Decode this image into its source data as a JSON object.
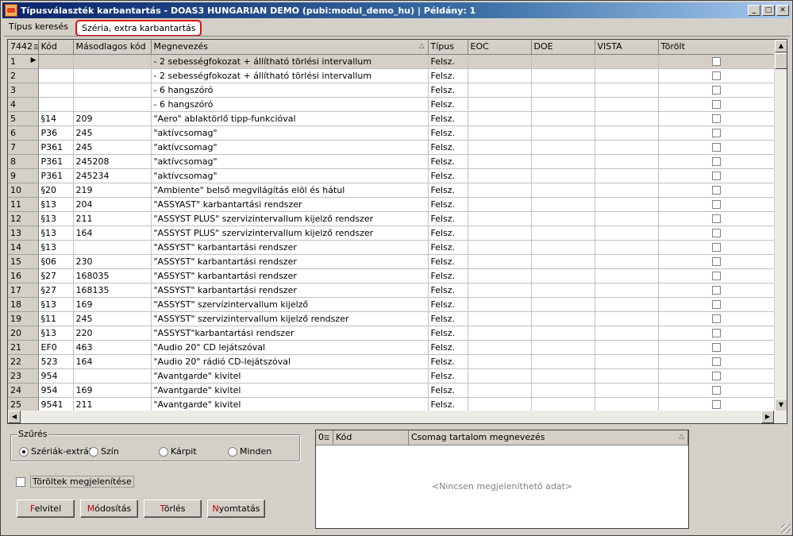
{
  "window": {
    "title": "Típusválaszték karbantartás - DOAS3 HUNGARIAN DEMO (pubi:modul_demo_hu) | Példány: 1",
    "minimize": "_",
    "maximize": "□",
    "close": "✕"
  },
  "tabs": [
    {
      "label": "Típus keresés"
    },
    {
      "label": "Széria, extra karbantartás"
    }
  ],
  "grid": {
    "row_count": "7442",
    "columns": [
      "Kód",
      "Másodlagos kód",
      "Megnevezés",
      "Típus",
      "EOC",
      "DOE",
      "VISTA",
      "Törölt"
    ],
    "rows": [
      {
        "n": "1",
        "kod": "",
        "masod": "",
        "megn": "- 2 sebességfokozat + állítható törlési intervallum",
        "tipus": "Felsz."
      },
      {
        "n": "2",
        "kod": "",
        "masod": "",
        "megn": "- 2 sebességfokozat + állítható törlési intervallum",
        "tipus": "Felsz."
      },
      {
        "n": "3",
        "kod": "",
        "masod": "",
        "megn": "- 6 hangszóró",
        "tipus": "Felsz."
      },
      {
        "n": "4",
        "kod": "",
        "masod": "",
        "megn": "- 6 hangszóró",
        "tipus": "Felsz."
      },
      {
        "n": "5",
        "kod": "§14",
        "masod": "209",
        "megn": "\"Aero\" ablaktörlő tipp-funkcióval",
        "tipus": "Felsz."
      },
      {
        "n": "6",
        "kod": "P36",
        "masod": "245",
        "megn": "\"aktívcsomag\"",
        "tipus": "Felsz."
      },
      {
        "n": "7",
        "kod": "P361",
        "masod": "245",
        "megn": "\"aktívcsomag\"",
        "tipus": "Felsz."
      },
      {
        "n": "8",
        "kod": "P361",
        "masod": "245208",
        "megn": "\"aktívcsomag\"",
        "tipus": "Felsz."
      },
      {
        "n": "9",
        "kod": "P361",
        "masod": "245234",
        "megn": "\"aktívcsomag\"",
        "tipus": "Felsz."
      },
      {
        "n": "10",
        "kod": "§20",
        "masod": "219",
        "megn": "\"Ambiente\" belső megvilágítás elöl és hátul",
        "tipus": "Felsz."
      },
      {
        "n": "11",
        "kod": "§13",
        "masod": "204",
        "megn": "\"ASSYAST\" karbantartási rendszer",
        "tipus": "Felsz."
      },
      {
        "n": "12",
        "kod": "§13",
        "masod": "211",
        "megn": "\"ASSYST PLUS\" szervizintervallum kijelző rendszer",
        "tipus": "Felsz."
      },
      {
        "n": "13",
        "kod": "§13",
        "masod": "164",
        "megn": "\"ASSYST PLUS\" szervizintervallum kijelző rendszer",
        "tipus": "Felsz."
      },
      {
        "n": "14",
        "kod": "§13",
        "masod": "",
        "megn": "\"ASSYST\" karbantartási rendszer",
        "tipus": "Felsz."
      },
      {
        "n": "15",
        "kod": "§06",
        "masod": "230",
        "megn": "\"ASSYST\" karbantartási rendszer",
        "tipus": "Felsz."
      },
      {
        "n": "16",
        "kod": "§27",
        "masod": "168035",
        "megn": "\"ASSYST\" karbantartási rendszer",
        "tipus": "Felsz."
      },
      {
        "n": "17",
        "kod": "§27",
        "masod": "168135",
        "megn": "\"ASSYST\" karbantartási rendszer",
        "tipus": "Felsz."
      },
      {
        "n": "18",
        "kod": "§13",
        "masod": "169",
        "megn": "\"ASSYST\" szervízintervallum kijelző",
        "tipus": "Felsz."
      },
      {
        "n": "19",
        "kod": "§11",
        "masod": "245",
        "megn": "\"ASSYST\" szervizintervallum kijelző rendszer",
        "tipus": "Felsz."
      },
      {
        "n": "20",
        "kod": "§13",
        "masod": "220",
        "megn": "\"ASSYST\"karbantartási rendszer",
        "tipus": "Felsz."
      },
      {
        "n": "21",
        "kod": "EF0",
        "masod": "463",
        "megn": "\"Audio 20\" CD lejátszóval",
        "tipus": "Felsz."
      },
      {
        "n": "22",
        "kod": "523",
        "masod": "164",
        "megn": "\"Audio 20\" rádió CD-lejátszóval",
        "tipus": "Felsz."
      },
      {
        "n": "23",
        "kod": "954",
        "masod": "",
        "megn": "\"Avantgarde\" kivitel",
        "tipus": "Felsz."
      },
      {
        "n": "24",
        "kod": "954",
        "masod": "169",
        "megn": "\"Avantgarde\" kivitel",
        "tipus": "Felsz."
      },
      {
        "n": "25",
        "kod": "9541",
        "masod": "211",
        "megn": "\"Avantgarde\" kivitel",
        "tipus": "Felsz."
      }
    ]
  },
  "filter": {
    "title": "Szűrés",
    "options": [
      "Szériák-extrák",
      "Szín",
      "Kárpit",
      "Minden"
    ],
    "selected": "Szériák-extrák"
  },
  "show_deleted_label": "Töröltek megjelenítése",
  "buttons": [
    {
      "accel": "F",
      "rest": "elvitel"
    },
    {
      "accel": "M",
      "rest": "ódosítás"
    },
    {
      "accel": "T",
      "rest": "örlés"
    },
    {
      "accel": "N",
      "rest": "yomtatás"
    }
  ],
  "subgrid": {
    "row_count": "0",
    "columns": [
      "Kód",
      "Csomag tartalom megnevezés"
    ],
    "empty_text": "<Nincsen megjeleníthető adat>"
  }
}
